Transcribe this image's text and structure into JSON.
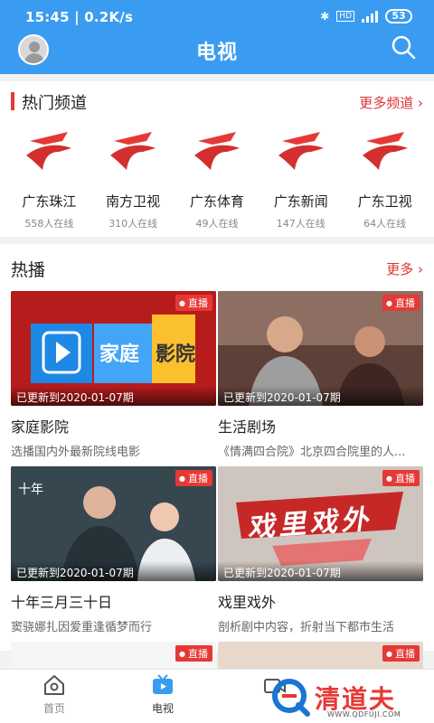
{
  "status_bar": {
    "time_speed": "15:45 | 0.2K/s",
    "battery": "53"
  },
  "header": {
    "title": "电视"
  },
  "channels": {
    "title": "热门频道",
    "more": "更多频道 ›",
    "items": [
      {
        "name": "广东珠江",
        "online": "558人在线"
      },
      {
        "name": "南方卫视",
        "online": "310人在线"
      },
      {
        "name": "广东体育",
        "online": "49人在线"
      },
      {
        "name": "广东新闻",
        "online": "147人在线"
      },
      {
        "name": "广东卫视",
        "online": "64人在线"
      }
    ]
  },
  "hot": {
    "title": "热播",
    "more": "更多 ›",
    "items": [
      {
        "live": "直播",
        "updated": "已更新到2020-01-07期",
        "title": "家庭影院",
        "desc": "选播国内外最新院线电影",
        "thumb_text_a": "家庭",
        "thumb_text_b": "影院"
      },
      {
        "live": "直播",
        "updated": "已更新到2020-01-07期",
        "title": "生活剧场",
        "desc": "《情满四合院》北京四合院里的人..."
      },
      {
        "live": "直播",
        "updated": "已更新到2020-01-07期",
        "title": "十年三月三十日",
        "desc": "窦骁娜扎因爱重逢循梦而行"
      },
      {
        "live": "直播",
        "updated": "已更新到2020-01-07期",
        "title": "戏里戏外",
        "desc": "剖析剧中内容，折射当下都市生活",
        "thumb_text": "戏里戏外"
      },
      {
        "live": "直播"
      },
      {
        "live": "直播"
      }
    ]
  },
  "tabbar": {
    "items": [
      {
        "label": "首页",
        "active": false
      },
      {
        "label": "电视",
        "active": true
      }
    ]
  },
  "watermark": {
    "text": "清道夫",
    "url": "WWW.QDFUJI.COM"
  },
  "colors": {
    "primary": "#3a9cf0",
    "accent": "#e53935"
  }
}
